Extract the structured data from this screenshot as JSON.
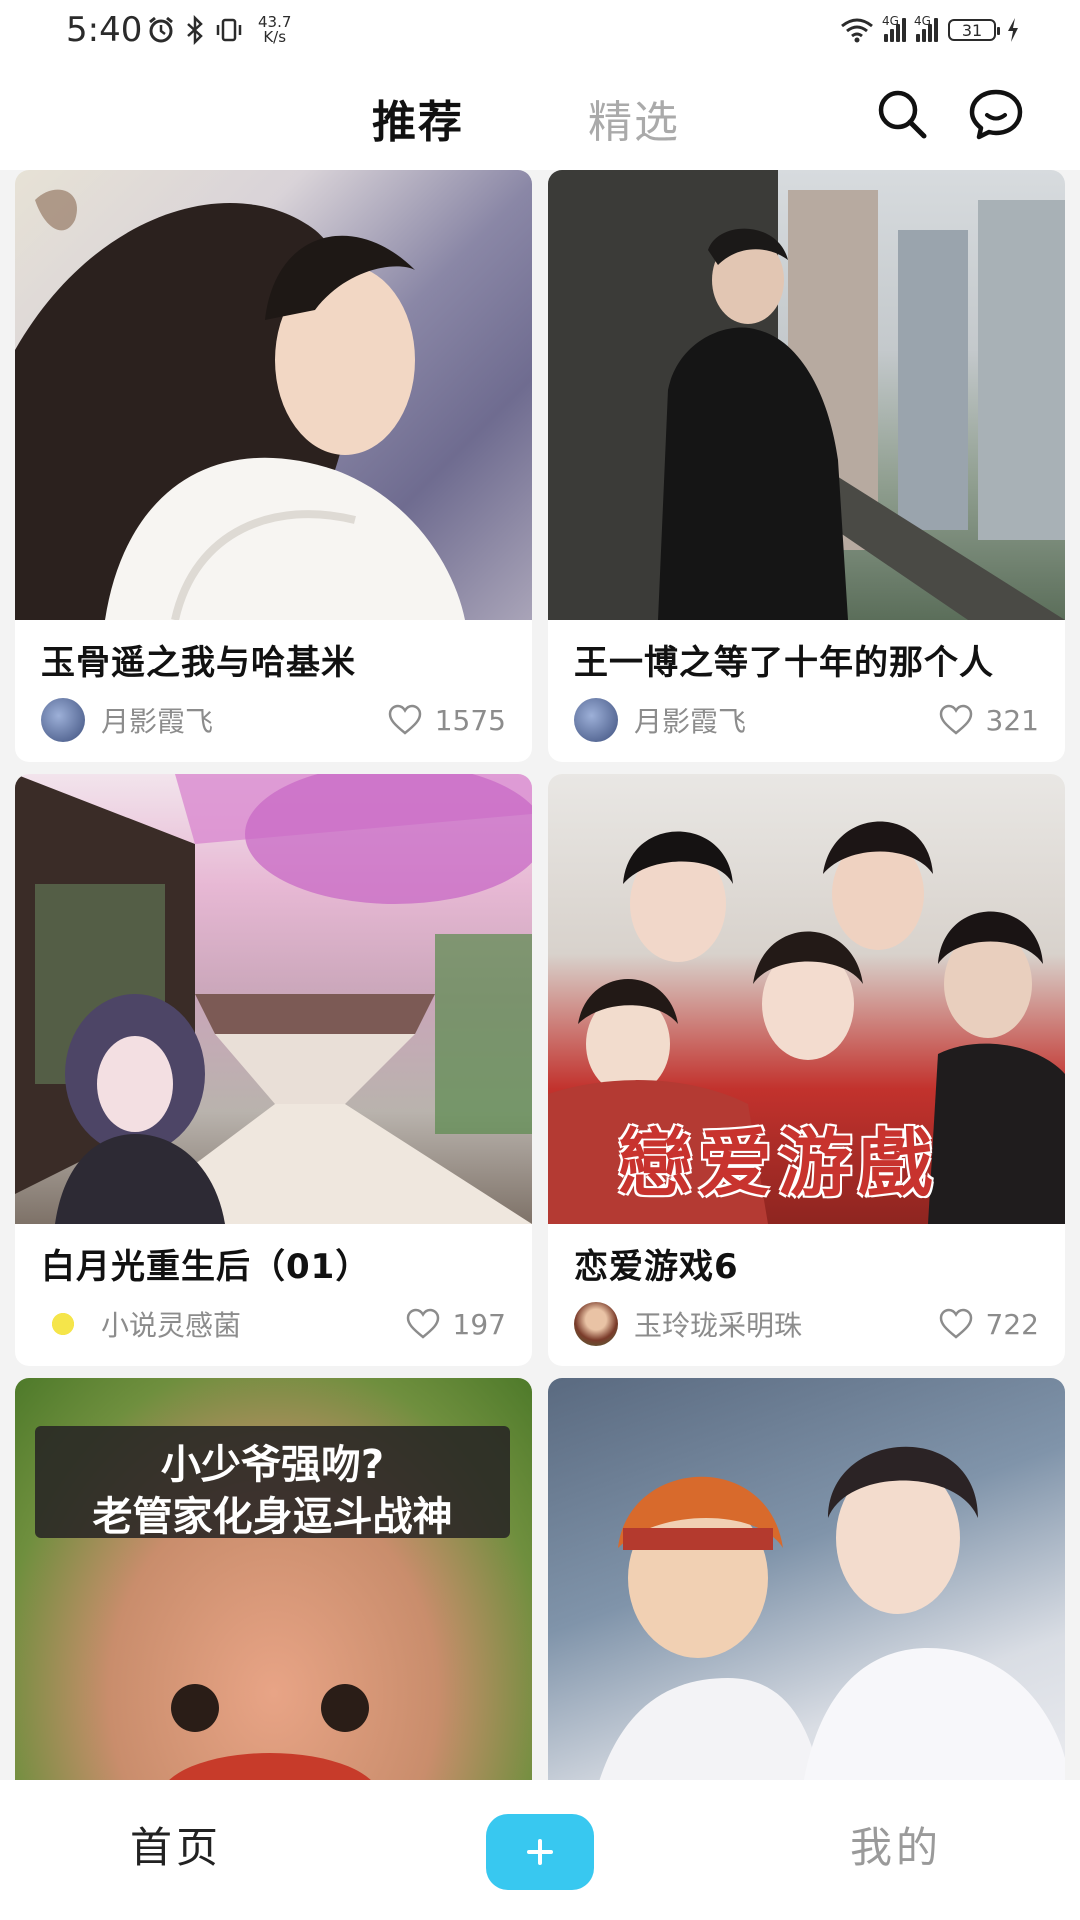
{
  "status_bar": {
    "time": "5:40",
    "speed_value": "43.7",
    "speed_unit": "K/s",
    "network_tag": "4G",
    "battery": "31"
  },
  "top_nav": {
    "tabs": [
      {
        "label": "推荐",
        "active": true
      },
      {
        "label": "精选",
        "active": false
      }
    ],
    "icons": [
      "search-icon",
      "chat-icon"
    ]
  },
  "feed": {
    "left_column": [
      {
        "title": "玉骨遥之我与哈基米",
        "author": "月影霞飞",
        "likes": "1575"
      },
      {
        "title": "白月光重生后（01）",
        "author": "小说灵感菌",
        "likes": "197"
      },
      {
        "thumb_text_1": "小少爷强吻?",
        "thumb_text_2": "老管家化身逗斗战神"
      }
    ],
    "right_column": [
      {
        "title": "王一博之等了十年的那个人",
        "author": "月影霞飞",
        "likes": "321"
      },
      {
        "title": "恋爱游戏6",
        "author": "玉玲珑采明珠",
        "likes": "722",
        "thumb_text": "戀爱游戲"
      },
      {}
    ]
  },
  "bottom_nav": {
    "home_label": "首页",
    "add_label": "+",
    "mine_label": "我的"
  },
  "colors": {
    "accent": "#38c8f0",
    "title": "#111111",
    "meta": "#8c8c8c",
    "inactive_tab": "#aaaaaa"
  }
}
